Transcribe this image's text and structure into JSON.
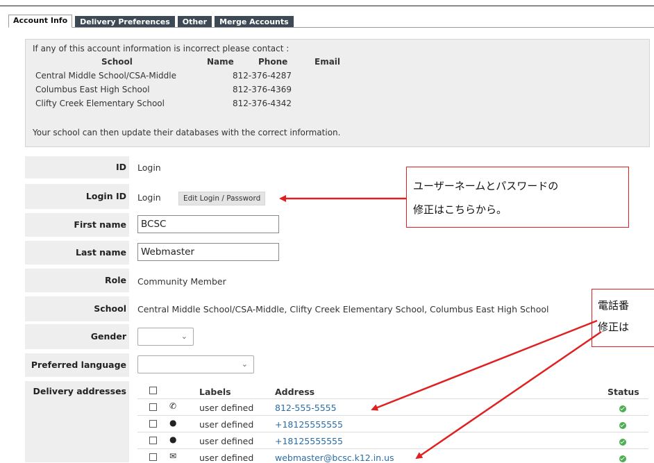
{
  "tabs": [
    {
      "label": "Account Info",
      "active": true
    },
    {
      "label": "Delivery Preferences",
      "active": false
    },
    {
      "label": "Other",
      "active": false
    },
    {
      "label": "Merge Accounts",
      "active": false
    }
  ],
  "contact_box": {
    "intro": "If any of this account information is incorrect please contact :",
    "headers": {
      "school": "School",
      "name": "Name",
      "phone": "Phone",
      "email": "Email"
    },
    "rows": [
      {
        "school": "Central Middle School/CSA-Middle",
        "phone": "812-376-4287"
      },
      {
        "school": "Columbus East High School",
        "phone": "812-376-4369"
      },
      {
        "school": "Clifty Creek Elementary School",
        "phone": "812-376-4342"
      }
    ],
    "footer": "Your school can then update their databases with the correct information."
  },
  "form": {
    "id": {
      "label": "ID",
      "value": "Login"
    },
    "login_id": {
      "label": "Login ID",
      "value": "Login",
      "button": "Edit Login / Password"
    },
    "first_name": {
      "label": "First name",
      "value": "BCSC"
    },
    "last_name": {
      "label": "Last name",
      "value": "Webmaster"
    },
    "role": {
      "label": "Role",
      "value": "Community Member"
    },
    "school": {
      "label": "School",
      "value": "Central Middle School/CSA-Middle, Clifty Creek Elementary School, Columbus East High School"
    },
    "gender": {
      "label": "Gender",
      "value": ""
    },
    "preferred_language": {
      "label": "Preferred language",
      "value": ""
    },
    "delivery": {
      "label": "Delivery addresses",
      "headers": {
        "labels": "Labels",
        "address": "Address",
        "status": "Status"
      },
      "rows": [
        {
          "icon": "phone-icon",
          "label": "user defined",
          "address": "812-555-5555",
          "status": "ok"
        },
        {
          "icon": "chat-icon",
          "label": "user defined",
          "address": "+18125555555",
          "status": "ok"
        },
        {
          "icon": "chat-icon",
          "label": "user defined",
          "address": "+18125555555",
          "status": "ok"
        },
        {
          "icon": "email-icon",
          "label": "user defined",
          "address": "webmaster@bcsc.k12.in.us",
          "status": "ok"
        }
      ]
    }
  },
  "annotations": {
    "callout1": {
      "line1": "ユーザーネームとパスワードの",
      "line2": "修正はこちらから。"
    },
    "callout2": {
      "line1": "電話番",
      "line2": "修正は"
    },
    "color": "#e02020"
  }
}
